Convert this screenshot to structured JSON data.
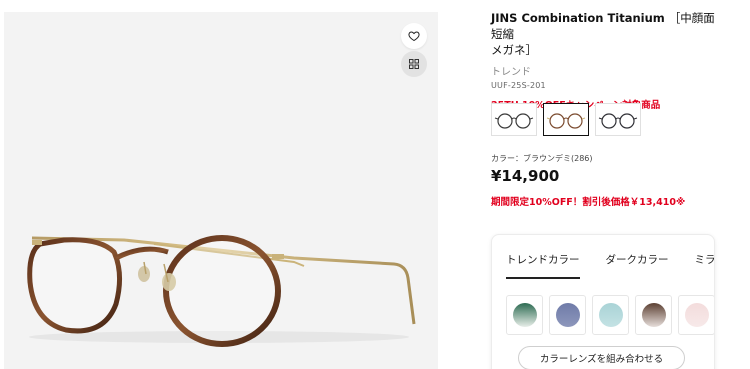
{
  "product": {
    "title_en": "JINS Combination Titanium",
    "title_jp_part1": "［中顔面短縮",
    "title_jp_part2": "メガネ］",
    "subtitle": "トレンド",
    "code": "UUF-25S-201",
    "campaign": "25TH  10%OFFキャンペーン対象商品",
    "color_label": "カラー：ブラウンデミ(286)",
    "price": "¥14,900",
    "sale_text": "期間限定10%OFF！割引後価格￥13,410※"
  },
  "actions": {
    "favorite_icon": "heart-icon",
    "ar_icon": "grid-icon"
  },
  "thumbnails": [
    {
      "color": "#3a3a3a",
      "selected": false
    },
    {
      "color": "#7a4a2e",
      "selected": true
    },
    {
      "color": "#2f2f35",
      "selected": false
    }
  ],
  "lens_panel": {
    "tabs": [
      {
        "label": "トレンドカラー",
        "active": true
      },
      {
        "label": "ダークカラー",
        "active": false
      },
      {
        "label": "ミラ",
        "active": false
      }
    ],
    "swatches": [
      {
        "name": "green-gradient",
        "top": "#2d6b52",
        "bottom": "#e8eee9"
      },
      {
        "name": "blue-gray",
        "top": "#6f7ba8",
        "bottom": "#8d97bc"
      },
      {
        "name": "light-aqua",
        "top": "#a9d3d6",
        "bottom": "#c4e2e4"
      },
      {
        "name": "brown-gradient",
        "top": "#5c4033",
        "bottom": "#e6dedb"
      },
      {
        "name": "light-pink",
        "top": "#f3dcdc",
        "bottom": "#f7e9e9"
      }
    ],
    "combine_button": "カラーレンズを組み合わせる"
  }
}
